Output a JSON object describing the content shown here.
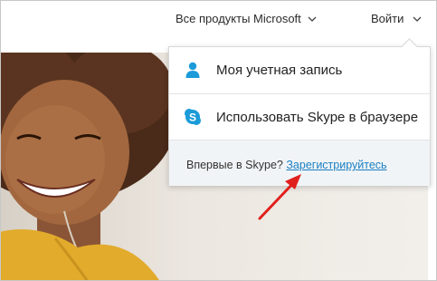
{
  "header": {
    "products_label": "Все продукты Microsoft",
    "signin_label": "Войти"
  },
  "dropdown": {
    "account_label": "Моя учетная запись",
    "skype_web_label": "Использовать Skype в браузере",
    "footer_text": "Впервые в Skype?",
    "register_link": "Зарегистрируйтесь"
  },
  "colors": {
    "accent": "#1a7fc4",
    "skype_blue": "#1b9bd8",
    "arrow_red": "#e0201d"
  },
  "icons": {
    "account": "person-icon",
    "skype": "skype-logo-icon",
    "chevron": "chevron-down-icon"
  }
}
